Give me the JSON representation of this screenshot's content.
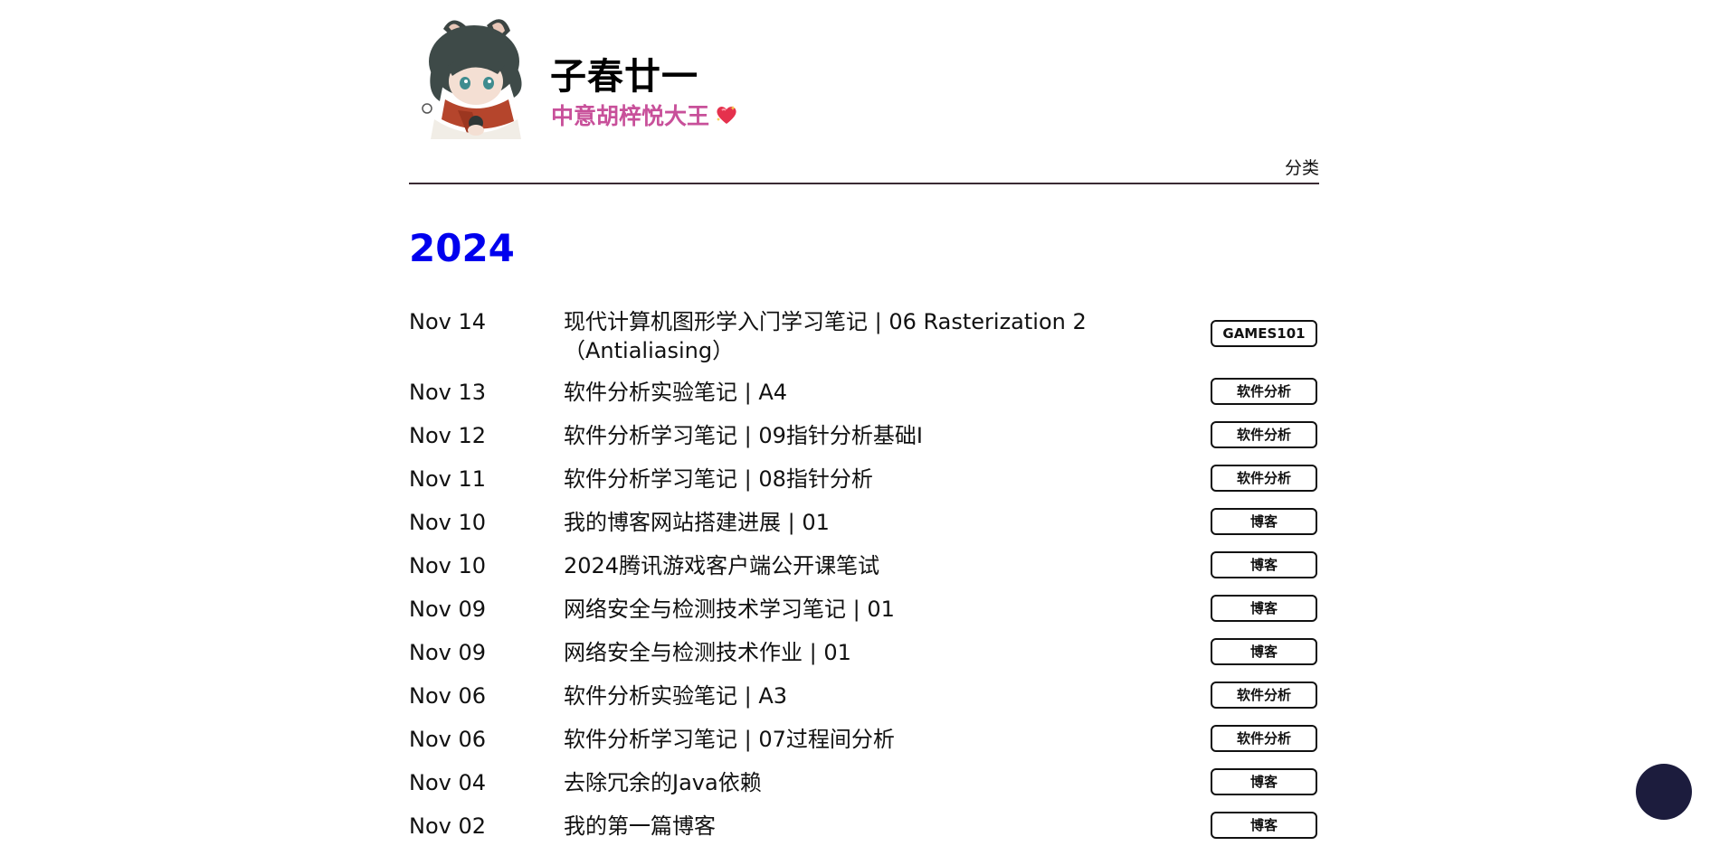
{
  "header": {
    "title": "子春廿一",
    "subtitle": "中意胡梓悦大王",
    "subtitle_emoji_icon": "sparkling-heart-icon",
    "nav": {
      "category_label": "分类"
    }
  },
  "colors": {
    "year": "#0000ee",
    "subtitle": "#c8509a",
    "rule": "#3a2a33",
    "fab": "#1c1c3d"
  },
  "archive": {
    "year": "2024",
    "posts": [
      {
        "date": "Nov 14",
        "title": "现代计算机图形学入门学习笔记 | 06 Rasterization 2（Antialiasing）",
        "tag": "GAMES101"
      },
      {
        "date": "Nov 13",
        "title": "软件分析实验笔记 | A4",
        "tag": "软件分析"
      },
      {
        "date": "Nov 12",
        "title": "软件分析学习笔记 | 09指针分析基础I",
        "tag": "软件分析"
      },
      {
        "date": "Nov 11",
        "title": "软件分析学习笔记 | 08指针分析",
        "tag": "软件分析"
      },
      {
        "date": "Nov 10",
        "title": "我的博客网站搭建进展 | 01",
        "tag": "博客"
      },
      {
        "date": "Nov 10",
        "title": "2024腾讯游戏客户端公开课笔试",
        "tag": "博客"
      },
      {
        "date": "Nov 09",
        "title": "网络安全与检测技术学习笔记 | 01",
        "tag": "博客"
      },
      {
        "date": "Nov 09",
        "title": "网络安全与检测技术作业 | 01",
        "tag": "博客"
      },
      {
        "date": "Nov 06",
        "title": "软件分析实验笔记 | A3",
        "tag": "软件分析"
      },
      {
        "date": "Nov 06",
        "title": "软件分析学习笔记 | 07过程间分析",
        "tag": "软件分析"
      },
      {
        "date": "Nov 04",
        "title": "去除冗余的Java依赖",
        "tag": "博客"
      },
      {
        "date": "Nov 02",
        "title": "我的第一篇博客",
        "tag": "博客"
      }
    ]
  }
}
